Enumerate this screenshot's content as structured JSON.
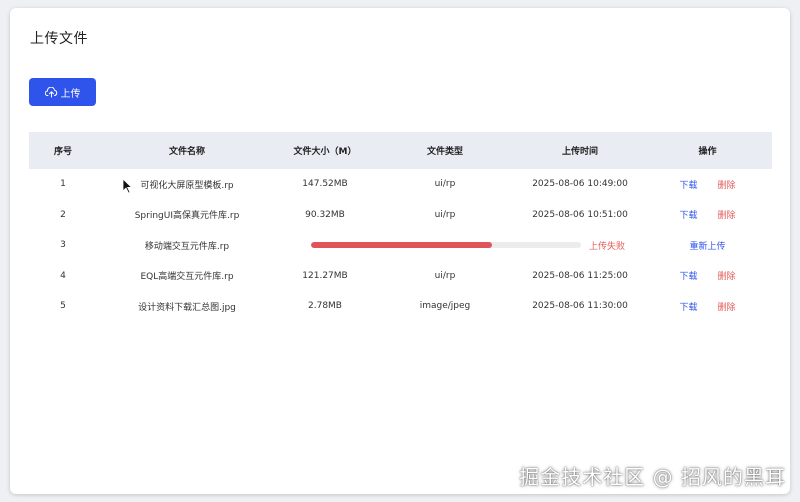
{
  "page": {
    "title": "上传文件"
  },
  "toolbar": {
    "upload_label": "上传",
    "upload_icon": "cloud-upload-icon"
  },
  "table": {
    "headers": [
      "序号",
      "文件名称",
      "文件大小（M）",
      "文件类型",
      "上传时间",
      "操作"
    ],
    "rows": [
      {
        "index": "1",
        "name": "可视化大屏原型模板.rp",
        "size": "147.52MB",
        "type": "ui/rp",
        "time": "2025-08-06 10:49:00",
        "download": "下载",
        "delete": "删除"
      },
      {
        "index": "2",
        "name": "SpringUI高保真元件库.rp",
        "size": "90.32MB",
        "type": "ui/rp",
        "time": "2025-08-06 10:51:00",
        "download": "下载",
        "delete": "删除"
      },
      {
        "index": "3",
        "name": "移动端交互元件库.rp",
        "progress": 0.67,
        "status": "上传失败",
        "retry": "重新上传"
      },
      {
        "index": "4",
        "name": "EQL高端交互元件库.rp",
        "size": "121.27MB",
        "type": "ui/rp",
        "time": "2025-08-06 11:25:00",
        "download": "下载",
        "delete": "删除"
      },
      {
        "index": "5",
        "name": "设计资料下载汇总图.jpg",
        "size": "2.78MB",
        "type": "image/jpeg",
        "time": "2025-08-06 11:30:00",
        "download": "下载",
        "delete": "删除"
      }
    ]
  },
  "colors": {
    "primary": "#2f54eb",
    "danger": "#e35b5b",
    "header_bg": "#e9edf3",
    "progress_fill": "#e0555a"
  },
  "watermark": {
    "text": "掘金技术社区 @ 招风的黑耳"
  }
}
